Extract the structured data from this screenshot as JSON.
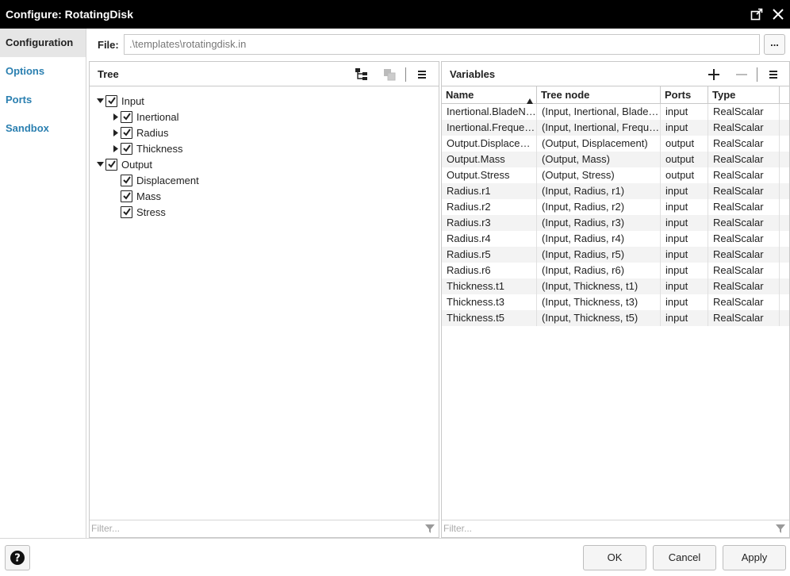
{
  "window": {
    "title": "Configure: RotatingDisk"
  },
  "sidebar": {
    "items": [
      {
        "label": "Configuration",
        "active": true
      },
      {
        "label": "Options"
      },
      {
        "label": "Ports"
      },
      {
        "label": "Sandbox"
      }
    ]
  },
  "file": {
    "label": "File:",
    "value": ".\\templates\\rotatingdisk.in",
    "browse_label": "..."
  },
  "tree_panel": {
    "title": "Tree",
    "filter_placeholder": "Filter...",
    "nodes": {
      "input": "Input",
      "inertional": "Inertional",
      "radius": "Radius",
      "thickness": "Thickness",
      "output": "Output",
      "displacement": "Displacement",
      "mass": "Mass",
      "stress": "Stress"
    }
  },
  "variables_panel": {
    "title": "Variables",
    "filter_placeholder": "Filter...",
    "columns": {
      "name": "Name",
      "node": "Tree node",
      "ports": "Ports",
      "type": "Type"
    },
    "rows": [
      {
        "name": "Inertional.BladeNumber",
        "node": "(Input, Inertional, BladeNumber)",
        "ports": "input",
        "type": "RealScalar"
      },
      {
        "name": "Inertional.Frequency",
        "node": "(Input, Inertional, Frequency)",
        "ports": "input",
        "type": "RealScalar"
      },
      {
        "name": "Output.Displacement",
        "node": "(Output, Displacement)",
        "ports": "output",
        "type": "RealScalar"
      },
      {
        "name": "Output.Mass",
        "node": "(Output, Mass)",
        "ports": "output",
        "type": "RealScalar"
      },
      {
        "name": "Output.Stress",
        "node": "(Output, Stress)",
        "ports": "output",
        "type": "RealScalar"
      },
      {
        "name": "Radius.r1",
        "node": "(Input, Radius, r1)",
        "ports": "input",
        "type": "RealScalar"
      },
      {
        "name": "Radius.r2",
        "node": "(Input, Radius, r2)",
        "ports": "input",
        "type": "RealScalar"
      },
      {
        "name": "Radius.r3",
        "node": "(Input, Radius, r3)",
        "ports": "input",
        "type": "RealScalar"
      },
      {
        "name": "Radius.r4",
        "node": "(Input, Radius, r4)",
        "ports": "input",
        "type": "RealScalar"
      },
      {
        "name": "Radius.r5",
        "node": "(Input, Radius, r5)",
        "ports": "input",
        "type": "RealScalar"
      },
      {
        "name": "Radius.r6",
        "node": "(Input, Radius, r6)",
        "ports": "input",
        "type": "RealScalar"
      },
      {
        "name": "Thickness.t1",
        "node": "(Input, Thickness, t1)",
        "ports": "input",
        "type": "RealScalar"
      },
      {
        "name": "Thickness.t3",
        "node": "(Input, Thickness, t3)",
        "ports": "input",
        "type": "RealScalar"
      },
      {
        "name": "Thickness.t5",
        "node": "(Input, Thickness, t5)",
        "ports": "input",
        "type": "RealScalar"
      }
    ]
  },
  "footer": {
    "ok": "OK",
    "cancel": "Cancel",
    "apply": "Apply"
  }
}
